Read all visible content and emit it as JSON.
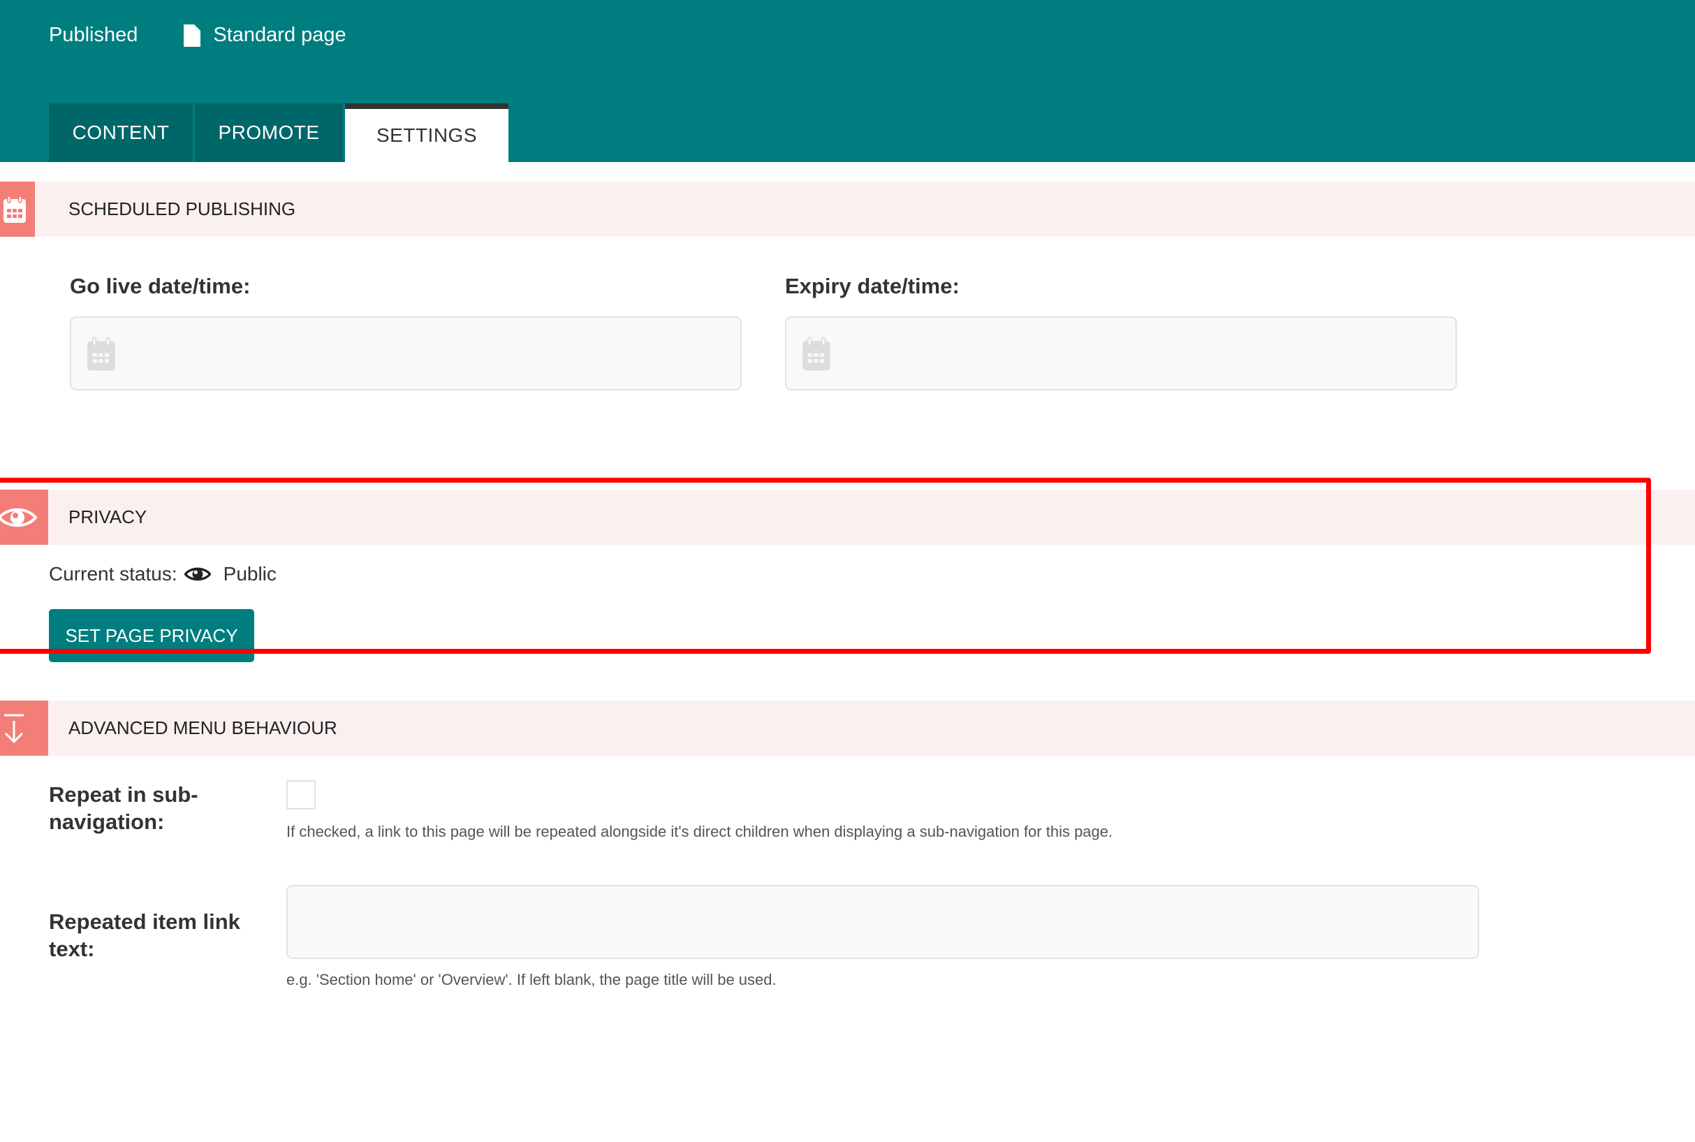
{
  "header": {
    "status": "Published",
    "page_type": "Standard page",
    "page_type_icon": "document-icon",
    "tabs": [
      {
        "label": "CONTENT",
        "active": false
      },
      {
        "label": "PROMOTE",
        "active": false
      },
      {
        "label": "SETTINGS",
        "active": true
      }
    ]
  },
  "scheduled_publishing": {
    "title": "SCHEDULED PUBLISHING",
    "icon": "calendar-icon",
    "go_live_label": "Go live date/time:",
    "go_live_value": "",
    "expiry_label": "Expiry date/time:",
    "expiry_value": ""
  },
  "privacy": {
    "title": "PRIVACY",
    "icon": "eye-icon",
    "status_label": "Current status:",
    "status_value": "Public",
    "button_label": "SET PAGE PRIVACY"
  },
  "advanced_menu": {
    "title": "ADVANCED MENU BEHAVIOUR",
    "icon": "arrow-down-icon",
    "repeat_label": "Repeat in sub-navigation:",
    "repeat_checked": false,
    "repeat_help": "If checked, a link to this page will be repeated alongside it's direct children when displaying a sub-navigation for this page.",
    "link_text_label": "Repeated item link text:",
    "link_text_value": "",
    "link_text_help": "e.g. 'Section home' or 'Overview'. If left blank, the page title will be used."
  },
  "colors": {
    "header_bg": "#007d7e",
    "tab_bg": "#006769",
    "section_bg": "#fbf0f0",
    "section_icon_bg": "#f37e77",
    "highlight": "#ff0000"
  }
}
